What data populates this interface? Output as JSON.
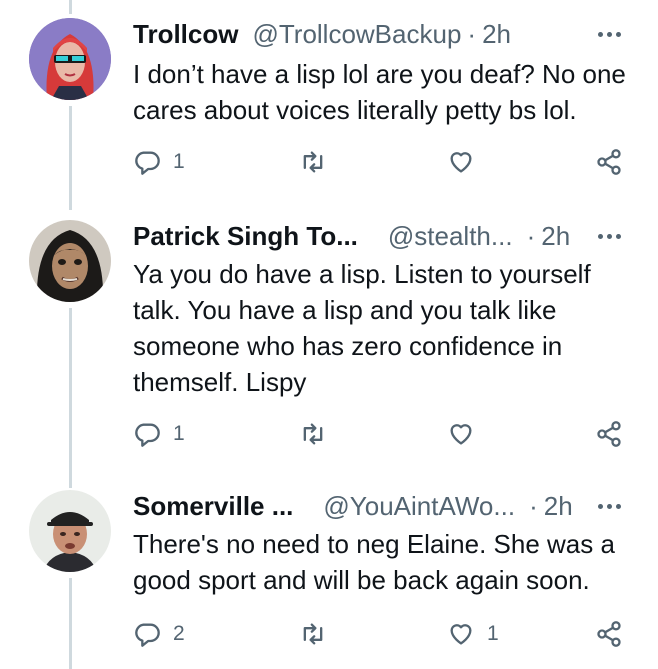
{
  "tweets": [
    {
      "name": "Trollcow",
      "handle": "@TrollcowBackup",
      "time": "2h",
      "lines": [
        "I don’t have a lisp lol are you deaf? No one",
        "cares about voices literally petty bs lol."
      ],
      "reply_count": "1",
      "retweet_count": "",
      "like_count": ""
    },
    {
      "name": "Patrick Singh To...",
      "handle": "@stealth...",
      "time": "2h",
      "lines": [
        "Ya you do have a lisp. Listen to yourself",
        "talk. You have a lisp and you talk like",
        "someone who has zero confidence in",
        "themself. Lispy"
      ],
      "reply_count": "1",
      "retweet_count": "",
      "like_count": ""
    },
    {
      "name": "Somerville ...",
      "handle": "@YouAintAWo...",
      "time": "2h",
      "lines": [
        "There's no need to neg Elaine. She was a",
        "good sport and will be back again soon."
      ],
      "reply_count": "2",
      "retweet_count": "",
      "like_count": "1"
    }
  ],
  "separator": "·",
  "colors": {
    "text": "#0f1419",
    "secondary": "#536471",
    "thread_line": "#cfd9de"
  },
  "icons": [
    "reply-icon",
    "retweet-icon",
    "like-icon",
    "share-icon",
    "more-icon"
  ]
}
